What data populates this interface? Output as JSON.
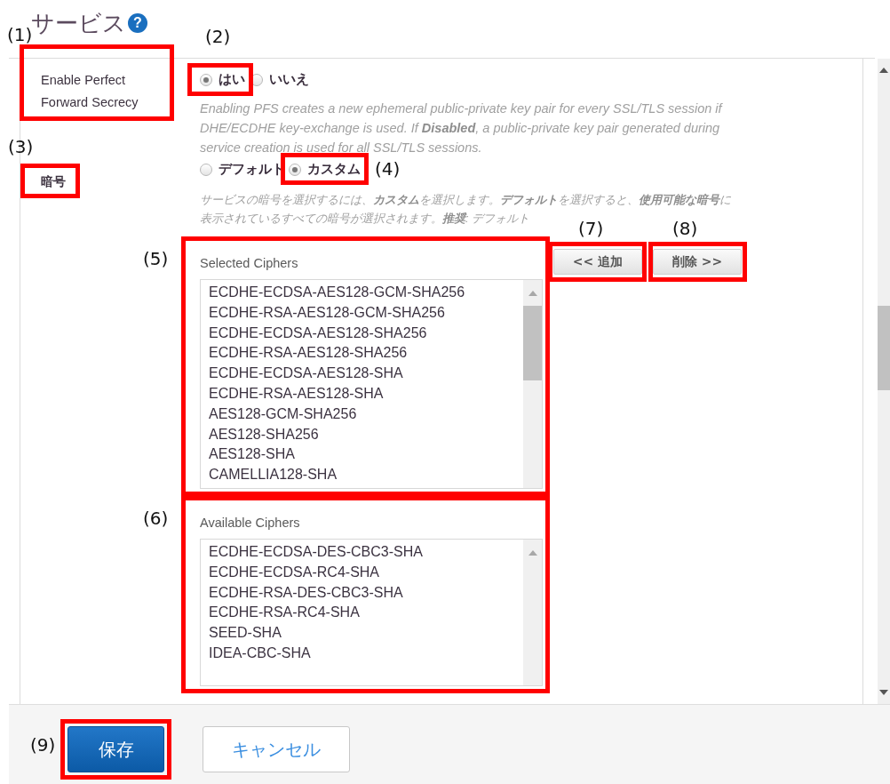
{
  "title": "サービス",
  "help_icon": "?",
  "pfs": {
    "label": "Enable Perfect Forward Secrecy",
    "options": [
      {
        "label": "はい",
        "selected": true
      },
      {
        "label": "いいえ",
        "selected": false
      }
    ],
    "description": "Enabling PFS creates a new ephemeral public-private key pair for every SSL/TLS session if DHE/ECDHE key-exchange is used. If **Disabled**, a public-private key pair generated during service creation is used for all SSL/TLS sessions."
  },
  "ciphers": {
    "label": "暗号",
    "options": [
      {
        "label": "デフォルト",
        "selected": false
      },
      {
        "label": "カスタム",
        "selected": true
      }
    ],
    "description": "サービスの暗号を選択するには、**カスタム**を選択します。**デフォルト**を選択すると、**使用可能な暗号**に表示されているすべての暗号が選択されます。**推奨**: デフォルト",
    "selected_label": "Selected Ciphers",
    "selected": [
      "ECDHE-ECDSA-AES128-GCM-SHA256",
      "ECDHE-RSA-AES128-GCM-SHA256",
      "ECDHE-ECDSA-AES128-SHA256",
      "ECDHE-RSA-AES128-SHA256",
      "ECDHE-ECDSA-AES128-SHA",
      "ECDHE-RSA-AES128-SHA",
      "AES128-GCM-SHA256",
      "AES128-SHA256",
      "AES128-SHA",
      "CAMELLIA128-SHA"
    ],
    "add_button": "<< 追加",
    "remove_button": "削除 >>",
    "available_label": "Available Ciphers",
    "available": [
      "ECDHE-ECDSA-DES-CBC3-SHA",
      "ECDHE-ECDSA-RC4-SHA",
      "ECDHE-RSA-DES-CBC3-SHA",
      "ECDHE-RSA-RC4-SHA",
      "SEED-SHA",
      "IDEA-CBC-SHA"
    ]
  },
  "buttons": {
    "save": "保存",
    "cancel": "キャンセル"
  },
  "annotations": [
    {
      "label": "(1)"
    },
    {
      "label": "(2)"
    },
    {
      "label": "(3)"
    },
    {
      "label": "(4)"
    },
    {
      "label": "(5)"
    },
    {
      "label": "(6)"
    },
    {
      "label": "(7)"
    },
    {
      "label": "(8)"
    },
    {
      "label": "(9)"
    }
  ]
}
